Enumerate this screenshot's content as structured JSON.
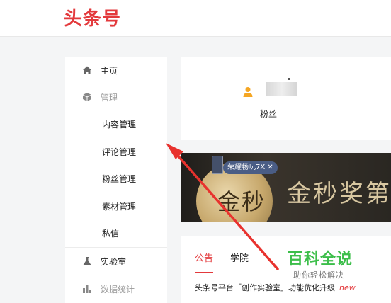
{
  "header": {
    "logo_text": "头条号"
  },
  "sidebar": {
    "items": [
      {
        "label": "主页",
        "icon": "home-icon"
      },
      {
        "label": "管理",
        "icon": "cube-icon"
      },
      {
        "label": "内容管理"
      },
      {
        "label": "评论管理"
      },
      {
        "label": "粉丝管理"
      },
      {
        "label": "素材管理"
      },
      {
        "label": "私信"
      },
      {
        "label": "实验室",
        "icon": "flask-icon"
      },
      {
        "label": "数据统计",
        "icon": "bar-chart-icon"
      }
    ]
  },
  "stats": {
    "fans_label": "粉丝"
  },
  "banner": {
    "badge_text": "荣耀畅玩7X",
    "medal_text": "金秒奖",
    "title": "金秒奖第"
  },
  "notice_panel": {
    "tabs": [
      "公告",
      "学院"
    ],
    "notice_text": "头条号平台「创作实验室」功能优化升级",
    "notice_badge": "new"
  },
  "watermark": {
    "title": "百科全说",
    "subtitle": "助你轻松解决"
  },
  "colors": {
    "brand_red": "#e3393c",
    "accent_orange": "#f5a623",
    "watermark_green": "#3cbe4a"
  }
}
